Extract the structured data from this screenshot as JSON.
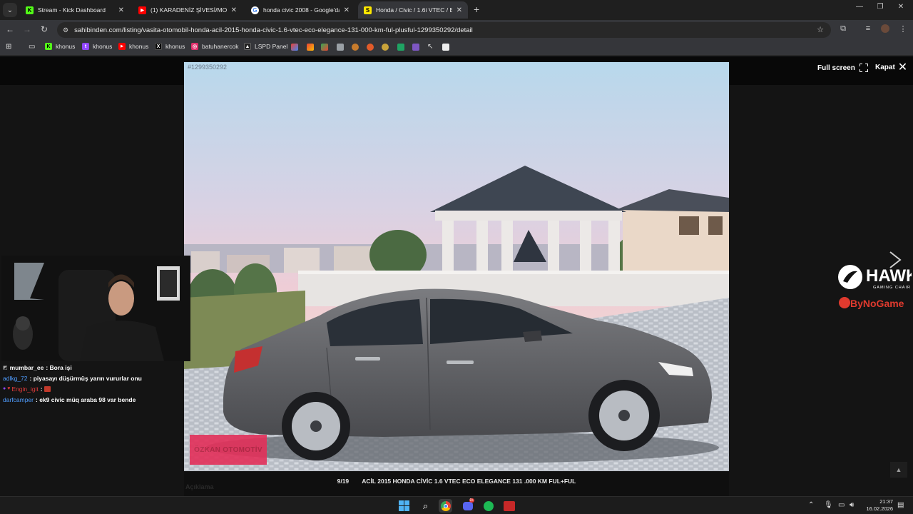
{
  "tabs": [
    {
      "title": "Stream - Kick Dashboard",
      "icon": "kick-icon",
      "color": "#53fc18"
    },
    {
      "title": "(1) KARADENİZ ŞİVESİ/MOR SİGARA",
      "icon": "youtube-icon",
      "color": "#ff0000"
    },
    {
      "title": "honda civic 2008 - Google'da Ara",
      "icon": "google-icon",
      "color": "#ffffff"
    },
    {
      "title": "Honda / Civic / 1.6i VTEC / Eco",
      "icon": "sahibinden-icon",
      "color": "#ffe800",
      "fav_letter": "S",
      "active": true
    }
  ],
  "address_bar": {
    "url": "sahibinden.com/listing/vasita-otomobil-honda-acil-2015-honda-civic-1.6-vtec-eco-elegance-131-000-km-ful-plusful-1299350292/detail"
  },
  "bookmarks": [
    {
      "label": "khonus",
      "icon": "kick-icon",
      "color": "#53fc18"
    },
    {
      "label": "khonus",
      "icon": "twitch-icon",
      "color": "#9146ff"
    },
    {
      "label": "khonus",
      "icon": "youtube-icon",
      "color": "#ff0000"
    },
    {
      "label": "khonus",
      "icon": "x-icon",
      "color": "#000000"
    },
    {
      "label": "batuhanercok",
      "icon": "instagram-icon",
      "color": "#e1306c"
    },
    {
      "label": "LSPD Panel",
      "icon": "lspd-icon",
      "color": "#222222"
    }
  ],
  "viewer": {
    "listing_id": "#1299350292",
    "fullscreen_label": "Full screen",
    "close_label": "Kapat",
    "counter": "9/19",
    "caption": "ACİL 2015 HONDA CİVİC 1.6 VTEC ECO ELEGANCE 131 .000 KM FUL+FUL",
    "photo_stamp": "ÖZKAN OTOMOTİV",
    "below_text": "Açıklama"
  },
  "stream_chat": [
    {
      "user": "mumbar_ee",
      "user_color": "#ffffff",
      "msg": "Bora işi"
    },
    {
      "user": "adlkg_72",
      "user_color": "#4f9dff",
      "msg": "piyasayı düşürmüş yarın vururlar onu"
    },
    {
      "user": "Engin_igit",
      "user_color": "#e03b3b",
      "msg": ""
    },
    {
      "user": "darfcamper",
      "user_color": "#4f9dff",
      "msg": "ek9 civic müq araba 98 var bende"
    }
  ],
  "sponsor": {
    "brand": "HAWK",
    "sub": "GAMING CHAIR",
    "partner": "ByNoGame"
  },
  "taskbar": {
    "time": "21:37",
    "date": "16.02.2026",
    "discord_badge": "9+"
  }
}
